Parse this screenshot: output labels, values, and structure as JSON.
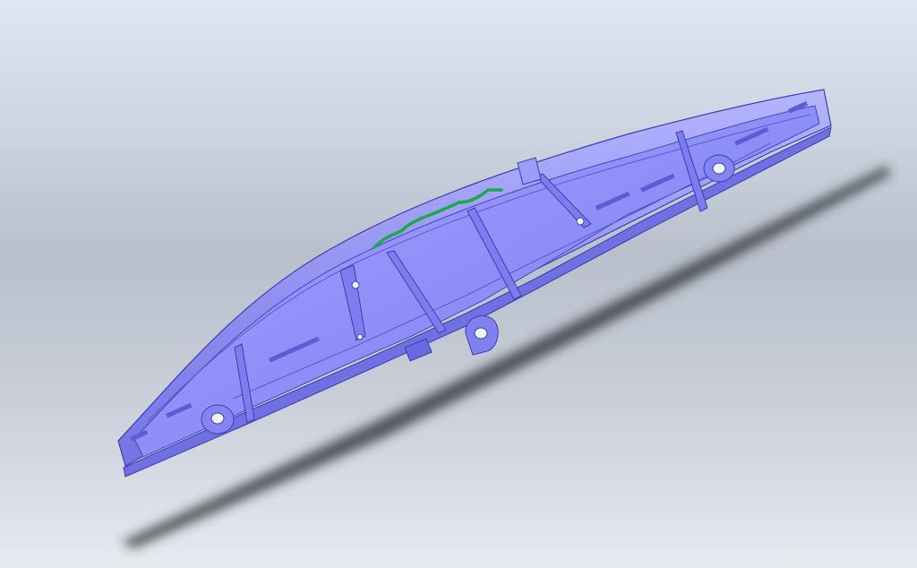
{
  "scene": {
    "part_color": "#8c8cf6",
    "part_dark": "#6d6de6",
    "part_light": "#a6a6ff",
    "edge_color": "#3d3db0",
    "highlight_curve_color": "#1fa84a",
    "shadow_color": "#2a2d33",
    "features": [
      "boss-hole-left",
      "boss-hole-right",
      "center-hinge-boss",
      "ribs",
      "snap-slots",
      "highlighted-edge"
    ]
  }
}
